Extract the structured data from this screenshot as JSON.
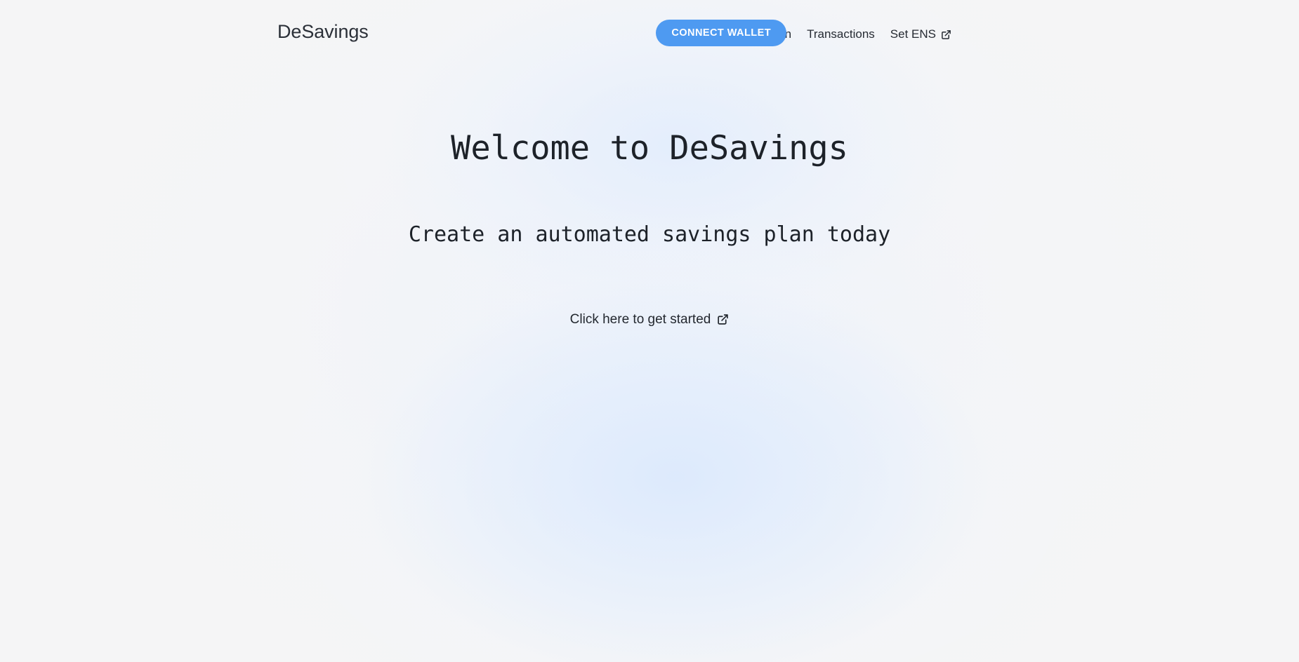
{
  "theme": {
    "page_background": "#f5f5f6",
    "glow_blue": "#dbe9fd",
    "accent_blue": "#4e9af1",
    "text_dark": "#1d2229",
    "nav_text": "#262b33",
    "button_text": "#ffffff"
  },
  "header": {
    "brand": "DeSavings",
    "nav_items": [
      {
        "label": "Create Plan",
        "icon": null
      },
      {
        "label": "Transactions",
        "icon": null
      },
      {
        "label": "Set ENS",
        "icon": "external-link-icon"
      }
    ],
    "connect_wallet_label": "CONNECT WALLET"
  },
  "hero": {
    "title": "Welcome to DeSavings",
    "subtitle": "Create an automated savings plan today",
    "cta_label": "Click here to get started",
    "cta_icon": "external-link-icon"
  }
}
